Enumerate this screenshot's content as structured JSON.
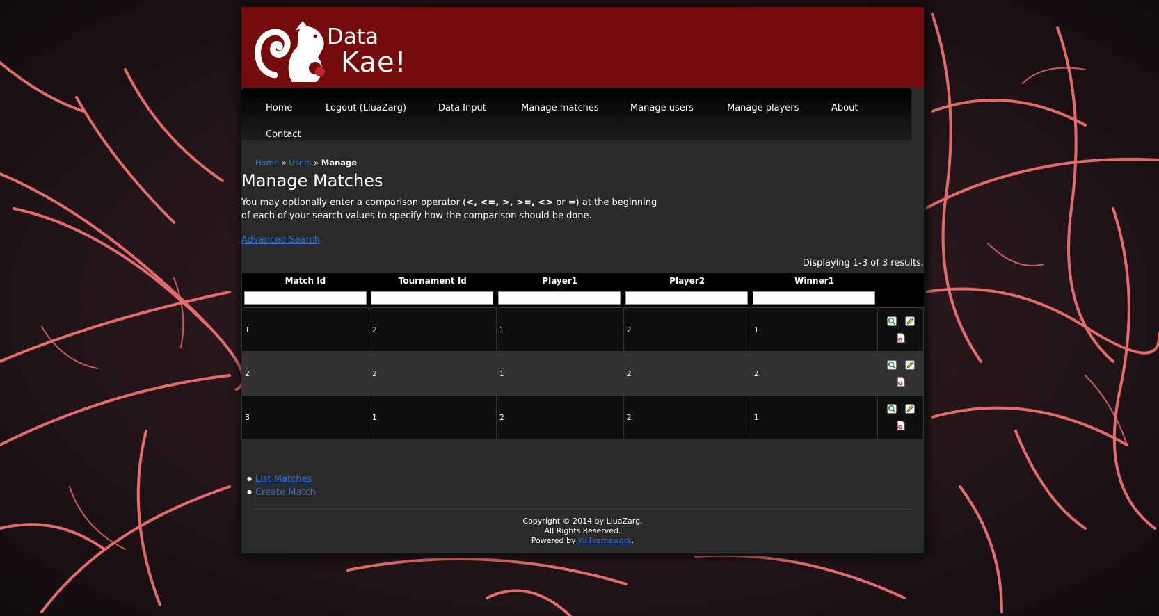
{
  "header": {
    "logo_line1": "Data",
    "logo_line2": "Kae!"
  },
  "menu": {
    "items": [
      {
        "label": "Home"
      },
      {
        "label": "Logout (LluaZarg)"
      },
      {
        "label": "Data Input"
      },
      {
        "label": "Manage matches"
      },
      {
        "label": "Manage users"
      },
      {
        "label": "Manage players"
      },
      {
        "label": "About"
      },
      {
        "label": "Contact"
      }
    ]
  },
  "breadcrumbs": {
    "home": "Home",
    "sep1": " » ",
    "users": "Users",
    "sep2": " » ",
    "current": "Manage"
  },
  "page": {
    "title": "Manage Matches",
    "hint_before": "You may optionally enter a comparison operator (",
    "hint_ops": "<, <=, >, >=, <>",
    "hint_after": " or =) at the beginning of each of your search values to specify how the comparison should be done.",
    "advanced_search": "Advanced Search",
    "summary": "Displaying 1-3 of 3 results."
  },
  "grid": {
    "columns": [
      "Match Id",
      "Tournament Id",
      "Player1",
      "Player2",
      "Winner1"
    ],
    "rows": [
      [
        "1",
        "2",
        "1",
        "2",
        "1"
      ],
      [
        "2",
        "2",
        "1",
        "2",
        "2"
      ],
      [
        "3",
        "1",
        "2",
        "2",
        "1"
      ]
    ],
    "icons": {
      "view": "view-icon",
      "update": "update-icon",
      "delete": "delete-icon"
    }
  },
  "operations": {
    "items": [
      {
        "label": "List Matches"
      },
      {
        "label": "Create Match"
      }
    ]
  },
  "footer": {
    "copyright": "Copyright © 2014 by LluaZarg.",
    "rights": "All Rights Reserved.",
    "powered_prefix": "Powered by ",
    "powered_link": "Yii Framework",
    "powered_suffix": "."
  },
  "colors": {
    "header_bg": "#760b0b",
    "page_bg": "#2a2a2a",
    "link": "#2f6fd6",
    "background_accent": "#f06a6a"
  }
}
